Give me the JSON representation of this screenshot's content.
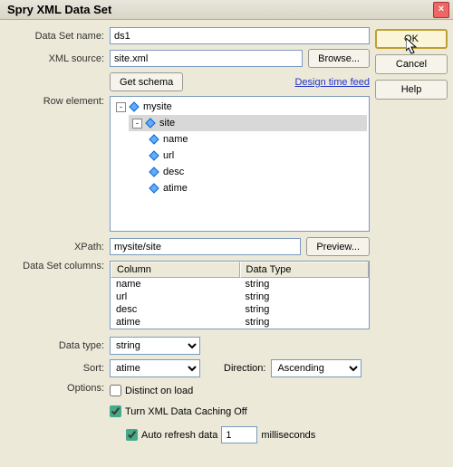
{
  "title": "Spry XML Data Set",
  "labels": {
    "dataSetName": "Data Set name:",
    "xmlSource": "XML source:",
    "rowElement": "Row element:",
    "xpath": "XPath:",
    "dataSetColumns": "Data Set columns:",
    "dataType": "Data type:",
    "sort": "Sort:",
    "direction": "Direction:",
    "options": "Options:",
    "milliseconds": "milliseconds"
  },
  "values": {
    "dataSetName": "ds1",
    "xmlSource": "site.xml",
    "xpath": "mysite/site",
    "dataType": "string",
    "sort": "atime",
    "direction": "Ascending",
    "autoRefresh": "1"
  },
  "buttons": {
    "ok": "OK",
    "cancel": "Cancel",
    "help": "Help",
    "browse": "Browse...",
    "getSchema": "Get schema",
    "preview": "Preview...",
    "designTimeFeed": "Design time feed"
  },
  "tree": {
    "root": "mysite",
    "child": "site",
    "leaves": [
      "name",
      "url",
      "desc",
      "atime"
    ]
  },
  "columns": {
    "headers": [
      "Column",
      "Data Type"
    ],
    "rows": [
      {
        "name": "name",
        "type": "string"
      },
      {
        "name": "url",
        "type": "string"
      },
      {
        "name": "desc",
        "type": "string"
      },
      {
        "name": "atime",
        "type": "string"
      }
    ]
  },
  "options": {
    "distinct": "Distinct on load",
    "cacheOff": "Turn XML Data Caching Off",
    "autoRefresh": "Auto refresh data"
  },
  "checks": {
    "distinct": false,
    "cacheOff": true,
    "autoRefresh": true
  }
}
